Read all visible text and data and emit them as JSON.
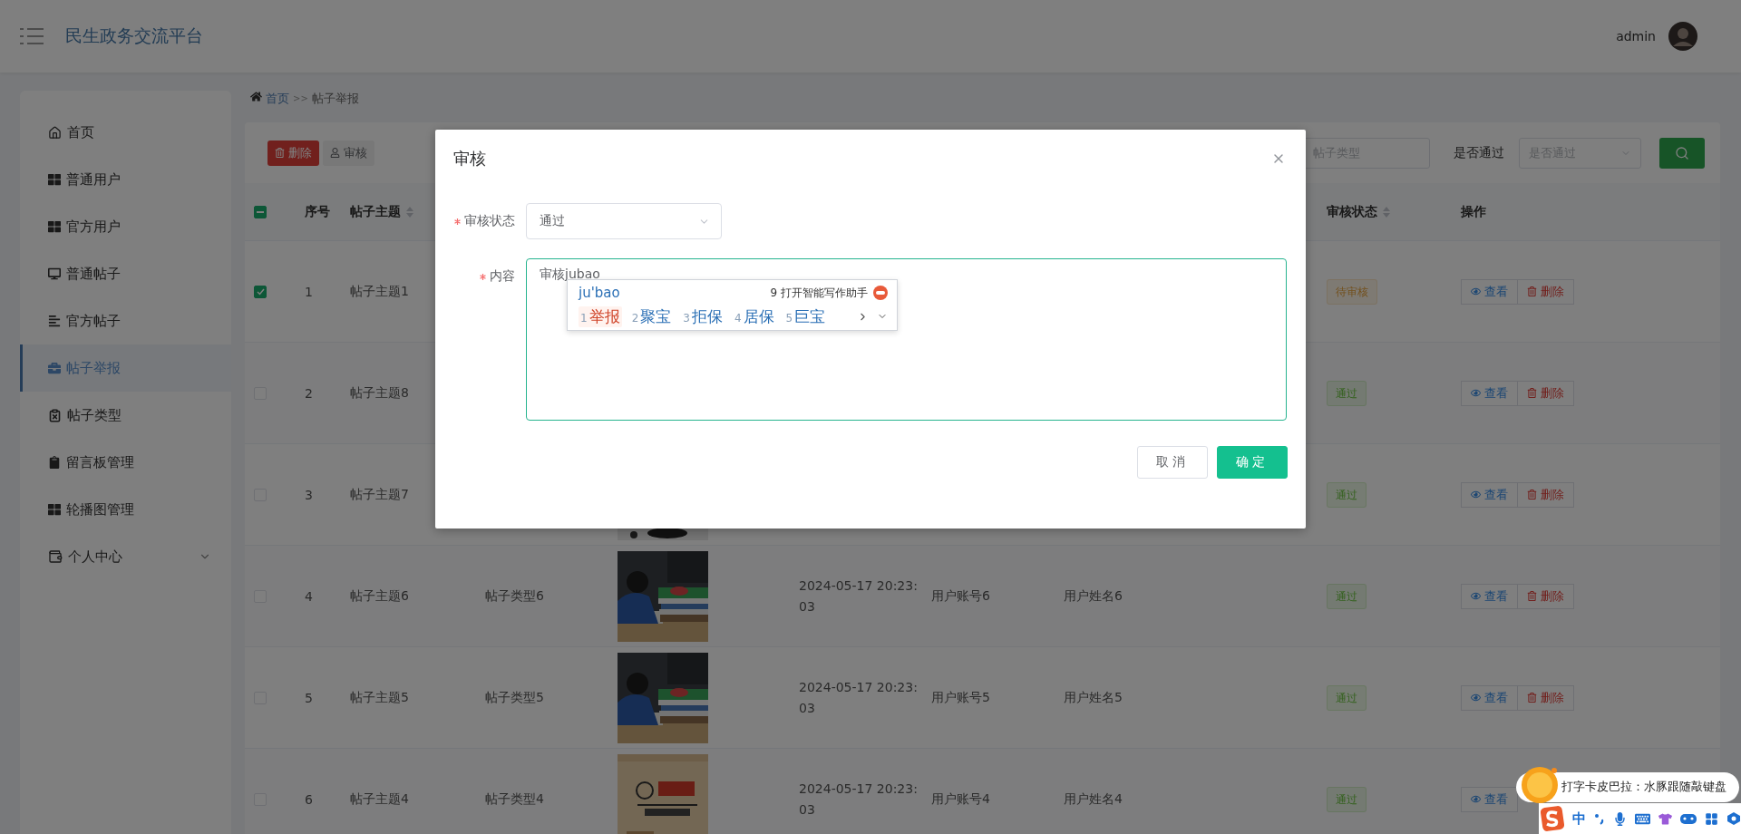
{
  "header": {
    "title": "民生政务交流平台",
    "user": "admin"
  },
  "sidebar": {
    "items": [
      {
        "label": "首页",
        "selected": false
      },
      {
        "label": "普通用户",
        "selected": false
      },
      {
        "label": "官方用户",
        "selected": false
      },
      {
        "label": "普通帖子",
        "selected": false
      },
      {
        "label": "官方帖子",
        "selected": false
      },
      {
        "label": "帖子举报",
        "selected": true
      },
      {
        "label": "帖子类型",
        "selected": false
      },
      {
        "label": "留言板管理",
        "selected": false
      },
      {
        "label": "轮播图管理",
        "selected": false
      },
      {
        "label": "个人中心",
        "selected": false,
        "expanded": false
      }
    ]
  },
  "breadcrumb": {
    "items": [
      "首页",
      "帖子举报"
    ],
    "separator": ">>"
  },
  "toolbar": {
    "buttons": [
      {
        "label": "删除",
        "kind": "danger"
      },
      {
        "label": "审核",
        "kind": "plain"
      }
    ],
    "filters": {
      "type_placeholder": "帖子类型",
      "pass_label": "是否通过",
      "pass_placeholder": "是否通过"
    }
  },
  "table": {
    "select_all": {
      "indeterminate": true
    },
    "columns": {
      "index": {
        "label": "序号"
      },
      "topic": {
        "label": "帖子主题",
        "sortable": true
      },
      "status": {
        "label": "审核状态",
        "sortable": true
      },
      "actions": {
        "label": "操作"
      }
    },
    "rows": [
      {
        "checked": true,
        "index": "1",
        "topic": "帖子主题1",
        "status": {
          "label": "待审核",
          "kind": "pending"
        },
        "actions": [
          {
            "label": "查看",
            "kind": "view"
          },
          {
            "label": "删除",
            "kind": "delete"
          }
        ]
      },
      {
        "checked": false,
        "index": "2",
        "topic": "帖子主题8",
        "status": {
          "label": "通过",
          "kind": "passed"
        },
        "actions": [
          {
            "label": "查看",
            "kind": "view"
          },
          {
            "label": "删除",
            "kind": "delete"
          }
        ]
      },
      {
        "checked": false,
        "index": "3",
        "topic": "帖子主题7",
        "image": {
          "kind": "picture"
        },
        "status": {
          "label": "通过",
          "kind": "passed"
        },
        "actions": [
          {
            "label": "查看",
            "kind": "view"
          },
          {
            "label": "删除",
            "kind": "delete"
          }
        ]
      },
      {
        "checked": false,
        "index": "4",
        "topic": "帖子主题6",
        "type": "帖子类型6",
        "image": {
          "kind": "picture"
        },
        "date": "2024-05-17 20:23:03",
        "account": "用户账号6",
        "name": "用户姓名6",
        "status": {
          "label": "通过",
          "kind": "passed"
        },
        "actions": [
          {
            "label": "查看",
            "kind": "view"
          },
          {
            "label": "删除",
            "kind": "delete"
          }
        ]
      },
      {
        "checked": false,
        "index": "5",
        "topic": "帖子主题5",
        "type": "帖子类型5",
        "image": {
          "kind": "picture"
        },
        "date": "2024-05-17 20:23:03",
        "account": "用户账号5",
        "name": "用户姓名5",
        "status": {
          "label": "通过",
          "kind": "passed"
        },
        "actions": [
          {
            "label": "查看",
            "kind": "view"
          },
          {
            "label": "删除",
            "kind": "delete"
          }
        ]
      },
      {
        "checked": false,
        "index": "6",
        "topic": "帖子主题4",
        "type": "帖子类型4",
        "image": {
          "kind": "picture"
        },
        "date": "2024-05-17 20:23:03",
        "account": "用户账号4",
        "name": "用户姓名4",
        "status": {
          "label": "通过",
          "kind": "passed"
        },
        "actions": [
          {
            "label": "查看",
            "kind": "view"
          }
        ]
      }
    ]
  },
  "dialog": {
    "title": "审核",
    "fields": [
      {
        "label": "审核状态",
        "required": true,
        "kind": "select",
        "value": "通过"
      },
      {
        "label": "内容",
        "required": true,
        "kind": "textarea",
        "value": "审核jubao"
      }
    ],
    "buttons": [
      {
        "label": "取消",
        "kind": "default"
      },
      {
        "label": "确定",
        "kind": "primary"
      }
    ]
  },
  "ime": {
    "composition": "ju'bao",
    "assistant_number": "9",
    "assistant_label": "打开智能写作助手",
    "candidates": [
      {
        "number": "1",
        "text": "举报",
        "selected": true
      },
      {
        "number": "2",
        "text": "聚宝",
        "selected": false
      },
      {
        "number": "3",
        "text": "拒保",
        "selected": false
      },
      {
        "number": "4",
        "text": "居保",
        "selected": false
      },
      {
        "number": "5",
        "text": "巨宝",
        "selected": false
      }
    ]
  },
  "ime_bubble": {
    "text": "打字卡皮巴拉：水豚跟随敲键盘"
  },
  "ime_toolbar": {
    "mode": "中"
  }
}
